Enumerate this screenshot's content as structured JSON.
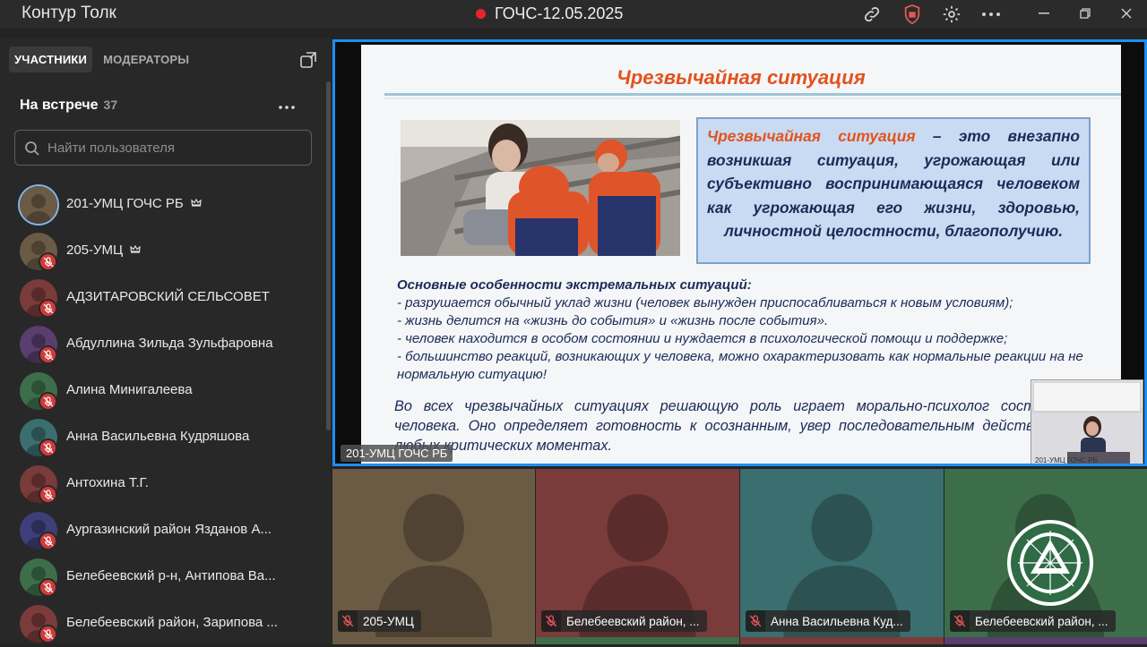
{
  "app": {
    "title": "Контур Толк"
  },
  "meeting": {
    "title": "ГОЧС-12.05.2025",
    "recording_color": "#e5262e"
  },
  "sidebar": {
    "tabs": [
      {
        "label": "УЧАСТНИКИ",
        "active": true
      },
      {
        "label": "МОДЕРАТОРЫ",
        "active": false
      }
    ],
    "section_label": "На встрече",
    "count": "37",
    "search_placeholder": "Найти пользователя",
    "participants": [
      {
        "name": "201-УМЦ ГОЧС РБ",
        "moderator": true,
        "muted": false,
        "avatar_color": "#6b5a44"
      },
      {
        "name": "205-УМЦ",
        "moderator": true,
        "muted": true,
        "avatar_color": "#6b5a44"
      },
      {
        "name": "АДЗИТАРОВСКИЙ СЕЛЬСОВЕТ",
        "moderator": false,
        "muted": true,
        "avatar_color": "#7a3b3b"
      },
      {
        "name": "Абдуллина Зильда Зульфаровна",
        "moderator": false,
        "muted": true,
        "avatar_color": "#5a3e6e"
      },
      {
        "name": "Алина Минигалеева",
        "moderator": false,
        "muted": true,
        "avatar_color": "#3d6e4a"
      },
      {
        "name": "Анна Васильевна Кудряшова",
        "moderator": false,
        "muted": true,
        "avatar_color": "#3b6e6e"
      },
      {
        "name": "Антохина Т.Г.",
        "moderator": false,
        "muted": true,
        "avatar_color": "#7a3b3b"
      },
      {
        "name": "Аургазинский район Язданов А...",
        "moderator": false,
        "muted": true,
        "avatar_color": "#3e3e78"
      },
      {
        "name": "Белебеевский р-н, Антипова Ва...",
        "moderator": false,
        "muted": true,
        "avatar_color": "#3d6e4a"
      },
      {
        "name": "Белебеевский район, Зарипова ...",
        "moderator": false,
        "muted": true,
        "avatar_color": "#7a3b3b"
      }
    ]
  },
  "main_video": {
    "label": "201-УМЦ ГОЧС РБ",
    "pip_label": "201-УМЦ ГОЧС РБ",
    "slide": {
      "title": "Чрезвычайная ситуация",
      "def_term": "Чрезвычайная ситуация",
      "def_rest": " – это внезапно возникшая ситуация, угрожающая или субъективно воспринимающаяся человеком как угрожающая его жизни, здоровью,",
      "def_last": "личностной целостности, благополучию.",
      "features_head": "Основные особенности экстремальных ситуаций:",
      "features": [
        "- разрушается обычный уклад жизни (человек вынужден приспосабливаться к новым условиям);",
        "- жизнь делится на «жизнь до события» и «жизнь после события».",
        "- человек находится в особом состоянии и нуждается в психологической помощи и поддержке;",
        "- большинство реакций, возникающих у человека, можно охарактеризовать как нормальные реакции на не нормальную ситуацию!"
      ],
      "conclusion": "Во всех чрезвычайных ситуациях решающую роль играет морально-психолог состояние человека. Оно определяет готовность к осознанным, увер последовательным действиям в любых критических моментах."
    }
  },
  "tiles": [
    {
      "name": "205-УМЦ",
      "color": "#6b5a44",
      "muted": true
    },
    {
      "name": "Белебеевский район, ...",
      "color": "#7a3b3b",
      "muted": true
    },
    {
      "name": "Анна Васильевна Куд...",
      "color": "#3b6e6e",
      "muted": true
    },
    {
      "name": "Белебеевский район, ...",
      "color": "#3d6e4a",
      "muted": true,
      "logo": true
    }
  ],
  "icons": [
    "link-icon",
    "shield-icon",
    "gear-icon",
    "more-icon",
    "minimize-icon",
    "restore-icon",
    "close-icon",
    "popout-icon",
    "search-icon",
    "crown-icon",
    "mic-off-icon"
  ]
}
